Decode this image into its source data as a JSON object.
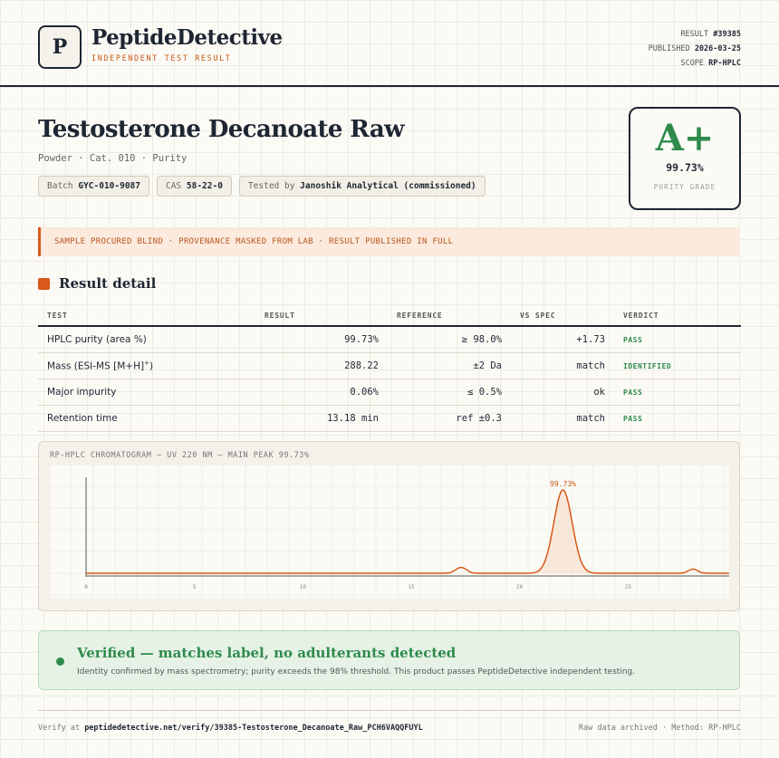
{
  "brand": {
    "logo_letter": "P",
    "name": "PeptideDetective",
    "tagline": "INDEPENDENT TEST RESULT"
  },
  "meta": {
    "result_label": "RESULT",
    "result_value": "#39385",
    "published_label": "PUBLISHED",
    "published_value": "2026-03-25",
    "scope_label": "SCOPE",
    "scope_value": "RP-HPLC"
  },
  "product": {
    "title": "Testosterone Decanoate Raw",
    "subtitle": "Powder · Cat. 010 · Purity",
    "batch_label": "Batch",
    "batch_value": "GYC-010-9087",
    "cas_label": "CAS",
    "cas_value": "58-22-0",
    "tested_label": "Tested by",
    "tested_value": "Janoshik Analytical (commissioned)"
  },
  "grade": {
    "letter": "A+",
    "value": "99.73%",
    "label": "PURITY GRADE"
  },
  "notice": "SAMPLE PROCURED BLIND · PROVENANCE MASKED FROM LAB · RESULT PUBLISHED IN FULL",
  "section_title": "Result detail",
  "table": {
    "headers": [
      "TEST",
      "RESULT",
      "REFERENCE",
      "VS SPEC",
      "VERDICT"
    ],
    "rows": [
      {
        "test": "HPLC purity (area %)",
        "test_sup": "",
        "result": "99.73%",
        "reference": "≥ 98.0%",
        "vs_spec": "+1.73",
        "verdict": "PASS"
      },
      {
        "test": "Mass (ESI-MS [M+H]",
        "test_sup": "+",
        "test_suffix": ")",
        "result": "288.22",
        "reference": "±2 Da",
        "vs_spec": "match",
        "verdict": "IDENTIFIED"
      },
      {
        "test": "Major impurity",
        "test_sup": "",
        "result": "0.06%",
        "reference": "≤ 0.5%",
        "vs_spec": "ok",
        "verdict": "PASS"
      },
      {
        "test": "Retention time",
        "test_sup": "",
        "result": "13.18 min",
        "reference": "ref ±0.3",
        "vs_spec": "match",
        "verdict": "PASS"
      }
    ]
  },
  "chart_data": {
    "type": "line",
    "title": "RP-HPLC CHROMATOGRAM — UV 220 NM — MAIN PEAK 99.73%",
    "x_ticks": [
      "0",
      "5",
      "10",
      "15",
      "20",
      "25",
      "30"
    ],
    "xlim": [
      0,
      30
    ],
    "peak_label": "99.73%",
    "peaks": [
      {
        "rt": 17.3,
        "height": 0.07,
        "width": 0.35
      },
      {
        "rt": 22.0,
        "height": 1.0,
        "width": 0.6
      },
      {
        "rt": 28.0,
        "height": 0.05,
        "width": 0.3
      }
    ],
    "color": "#d9591a"
  },
  "verified": {
    "title": "Verified — matches label, no adulterants detected",
    "body": "Identity confirmed by mass spectrometry; purity exceeds the 98% threshold. This product passes PeptideDetective independent testing."
  },
  "footer": {
    "verify_prefix": "Verify at",
    "verify_url": "peptidedetective.net/verify/39385-Testosterone_Decanoate_Raw_PCH6VAQQFUYL",
    "right": "Raw data archived · Method: RP-HPLC"
  }
}
